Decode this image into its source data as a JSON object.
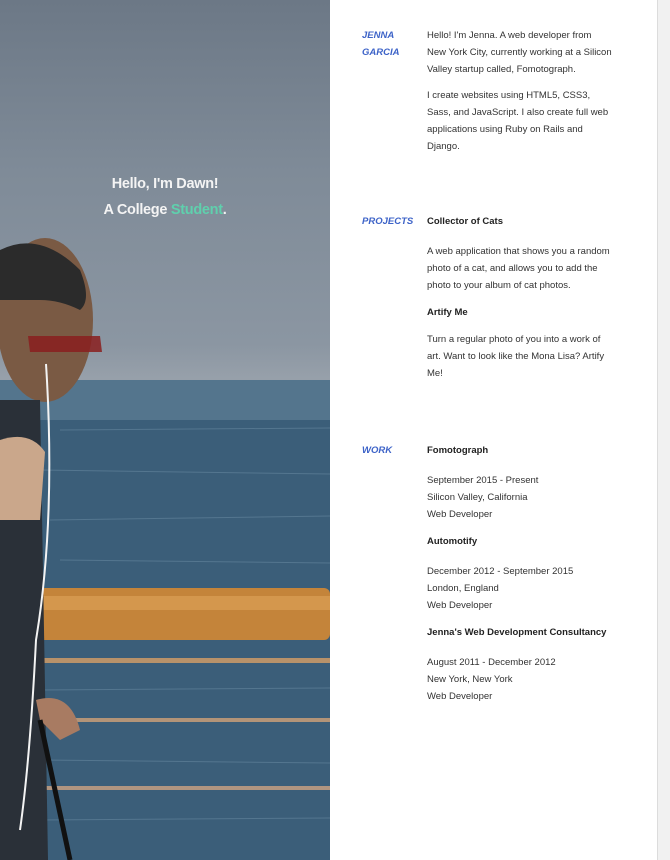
{
  "hero": {
    "line1": "Hello, I'm Dawn!",
    "line2_prefix": "A College ",
    "line2_accent": "Student",
    "line2_suffix": ".",
    "accent_color": "#5fd0ad"
  },
  "resume": {
    "name": "JENNA GARCIA",
    "about": [
      "Hello! I'm Jenna. A web developer from New York City, currently working at a Silicon Valley startup called, Fomotograph.",
      "I create websites using HTML5, CSS3, Sass, and JavaScript. I also create full web applications using Ruby on Rails and Django."
    ],
    "projects_label": "PROJECTS",
    "projects": [
      {
        "title": "Collector of Cats",
        "description": "A web application that shows you a random photo of a cat, and allows you to add the photo to your album of cat photos."
      },
      {
        "title": "Artify Me",
        "description": "Turn a regular photo of you into a work of art. Want to look like the Mona Lisa? Artify Me!"
      }
    ],
    "work_label": "WORK",
    "work": [
      {
        "company": "Fomotograph",
        "dates": "September 2015 - Present",
        "location": "Silicon Valley, California",
        "role": "Web Developer"
      },
      {
        "company": "Automotify",
        "dates": "December 2012 - September 2015",
        "location": "London, England",
        "role": "Web Developer"
      },
      {
        "company": "Jenna's Web Development Consultancy",
        "dates": "August 2011 - December 2012",
        "location": "New York, New York",
        "role": "Web Developer"
      }
    ],
    "label_color": "#3d63c8"
  }
}
